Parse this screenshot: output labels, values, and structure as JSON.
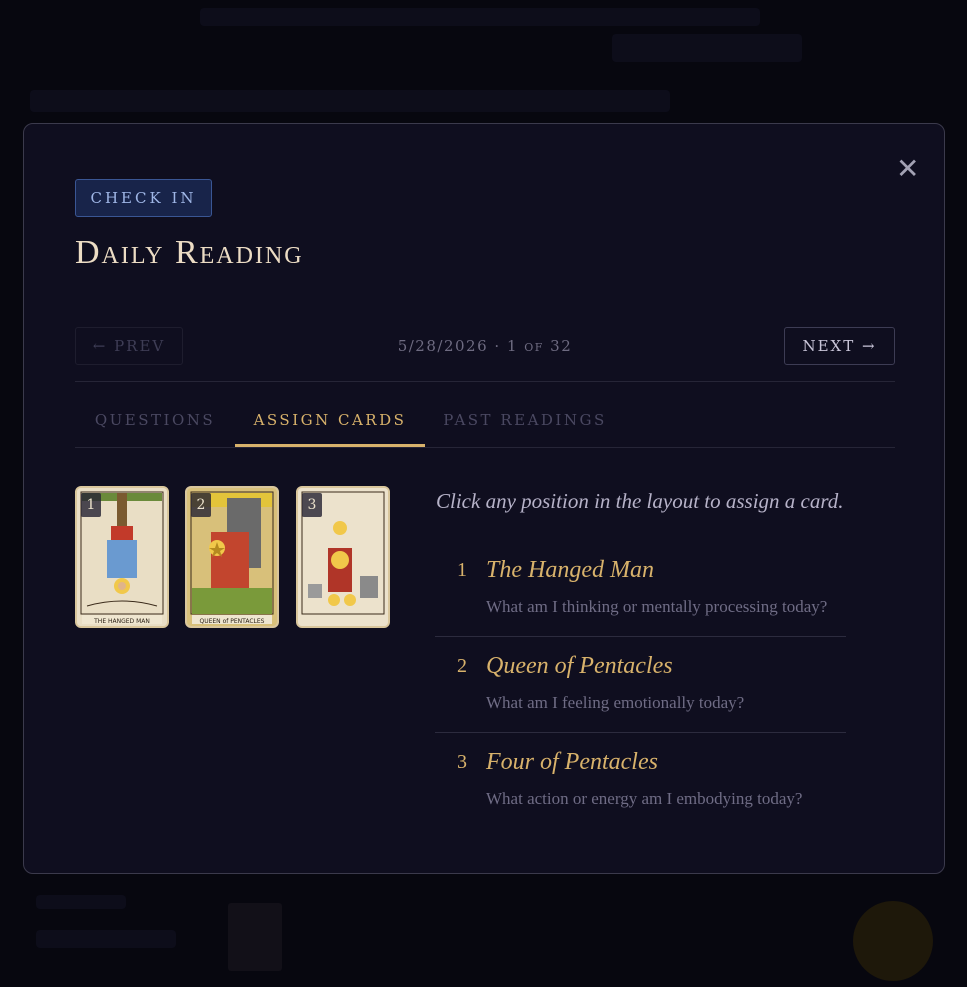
{
  "modal": {
    "badge": "CHECK IN",
    "title": "Daily Reading",
    "close_glyph": "✕",
    "nav": {
      "prev_label": "← PREV",
      "date": "5/28/2026",
      "position": "1 of 32",
      "next_label": "NEXT →"
    },
    "tabs": [
      {
        "label": "QUESTIONS",
        "active": false
      },
      {
        "label": "ASSIGN CARDS",
        "active": true
      },
      {
        "label": "PAST READINGS",
        "active": false
      }
    ],
    "instructions": "Click any position in the layout to assign a card.",
    "cards": [
      {
        "num": "1",
        "caption": "THE HANGED MAN",
        "icon": "hanged-man-card-art"
      },
      {
        "num": "2",
        "caption": "QUEEN of PENTACLES",
        "icon": "queen-of-pentacles-card-art"
      },
      {
        "num": "3",
        "caption": "",
        "icon": "four-of-pentacles-card-art"
      }
    ],
    "assignments": [
      {
        "num": "1",
        "card": "The Hanged Man",
        "question": "What am I thinking or mentally processing today?"
      },
      {
        "num": "2",
        "card": "Queen of Pentacles",
        "question": "What am I feeling emotionally today?"
      },
      {
        "num": "3",
        "card": "Four of Pentacles",
        "question": "What action or energy am I embodying today?"
      }
    ]
  },
  "colors": {
    "accent_gold": "#d8b26b",
    "modal_bg": "#0f0e1f",
    "badge_blue": "#18244a"
  }
}
